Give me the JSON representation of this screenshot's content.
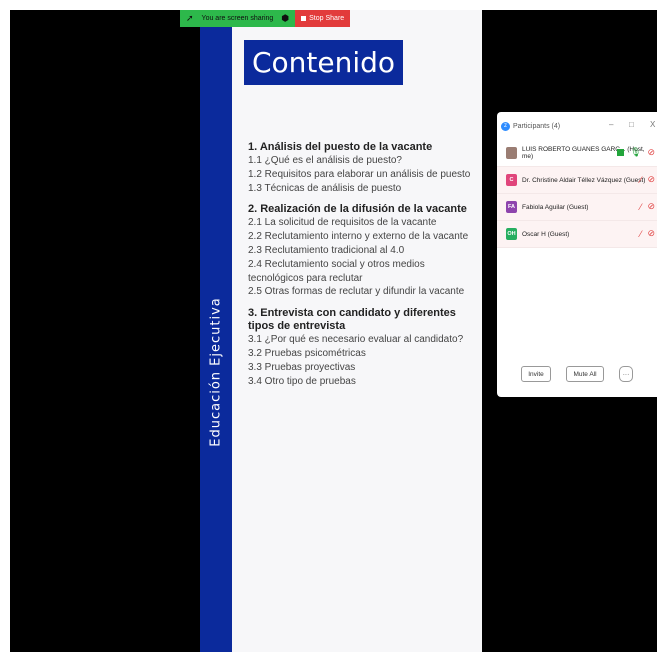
{
  "share_bar": {
    "status_text": "You are screen sharing",
    "stop_label": "Stop Share",
    "colors": {
      "green": "#2db84b",
      "red": "#e23b3b"
    }
  },
  "slide": {
    "vertical_label": "Educación Ejecutiva",
    "title": "Contenido",
    "accent": "#0b2a9c",
    "sections": [
      {
        "title": "1. Análisis del puesto de la vacante",
        "items": [
          "1.1 ¿Qué es el análisis de puesto?",
          "1.2 Requisitos para elaborar un análisis de puesto",
          "1.3 Técnicas de análisis de puesto"
        ]
      },
      {
        "title": "2. Realización de la difusión de la vacante",
        "items": [
          "2.1 La solicitud de requisitos de la vacante",
          "2.2 Reclutamiento interno y externo de la vacante",
          "2.3 Reclutamiento tradicional al 4.0",
          "2.4 Reclutamiento social y otros medios tecnológicos para reclutar",
          "2.5  Otras formas de reclutar y difundir la vacante"
        ]
      },
      {
        "title": "3. Entrevista con candidato y diferentes tipos de entrevista",
        "items": [
          "3.1 ¿Por qué es necesario evaluar al candidato?",
          "3.2 Pruebas psicométricas",
          "3.3 Pruebas proyectivas",
          "3.4 Otro tipo de pruebas"
        ]
      }
    ]
  },
  "participants_panel": {
    "title": "Participants (4)",
    "window_controls": {
      "minimize": "–",
      "maximize": "□",
      "close": "X"
    },
    "participants": [
      {
        "initials": "",
        "name": "LUIS ROBERTO GUANES GARC... (Host, me)",
        "avatar_color": "#9a7d73",
        "audio": "on"
      },
      {
        "initials": "C",
        "name": "Dr. Christine Aldair Téllez Vázquez (Guest)",
        "avatar_color": "#e0457b",
        "audio": "muted"
      },
      {
        "initials": "FA",
        "name": "Fabiola Aguilar (Guest)",
        "avatar_color": "#8e44ad",
        "audio": "muted"
      },
      {
        "initials": "OH",
        "name": "Oscar H (Guest)",
        "avatar_color": "#27ae60",
        "audio": "muted"
      }
    ],
    "buttons": {
      "invite": "Invite",
      "mute_all": "Mute All",
      "more": "···"
    }
  }
}
